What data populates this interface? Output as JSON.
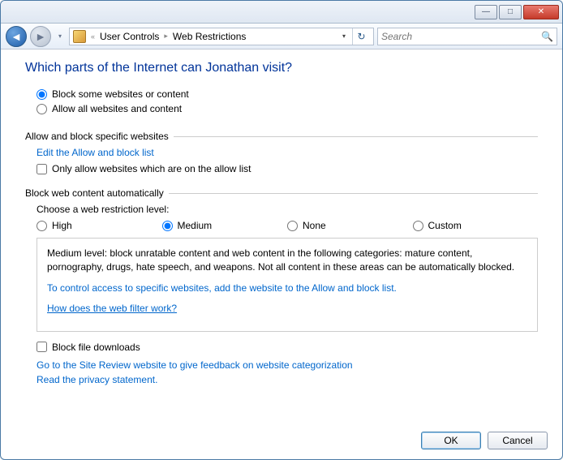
{
  "titlebar": {
    "minimize": "—",
    "maximize": "□",
    "close": "✕"
  },
  "nav": {
    "back": "◄",
    "forward": "►",
    "crumb_more": "«",
    "crumb1": "User Controls",
    "sep": "▸",
    "crumb2": "Web Restrictions",
    "dropdown": "▾",
    "refresh": "↻",
    "search_placeholder": "Search",
    "mag": "🔍"
  },
  "page": {
    "title": "Which parts of the Internet can Jonathan visit?",
    "opt_block_some": "Block some websites or content",
    "opt_allow_all": "Allow all websites and content",
    "group_allowblock": "Allow and block specific websites",
    "link_edit_list": "Edit the Allow and block list",
    "chk_only_allow": "Only allow websites which are on the allow list",
    "group_autoblock": "Block web content automatically",
    "choose_level": "Choose a web restriction level:",
    "levels": {
      "high": "High",
      "medium": "Medium",
      "none": "None",
      "custom": "Custom"
    },
    "desc_medium": "Medium level:  block unratable content and web content in the following categories:  mature content, pornography, drugs, hate speech, and weapons.  Not all content in these areas can be automatically blocked.",
    "desc_control": "To control access to specific websites, add the website to the Allow and block list.",
    "link_how_filter": "How does the web filter work?",
    "chk_block_downloads": "Block file downloads",
    "link_site_review": "Go to the Site Review website to give feedback on website categorization",
    "link_privacy": "Read the privacy statement.",
    "btn_ok": "OK",
    "btn_cancel": "Cancel"
  }
}
